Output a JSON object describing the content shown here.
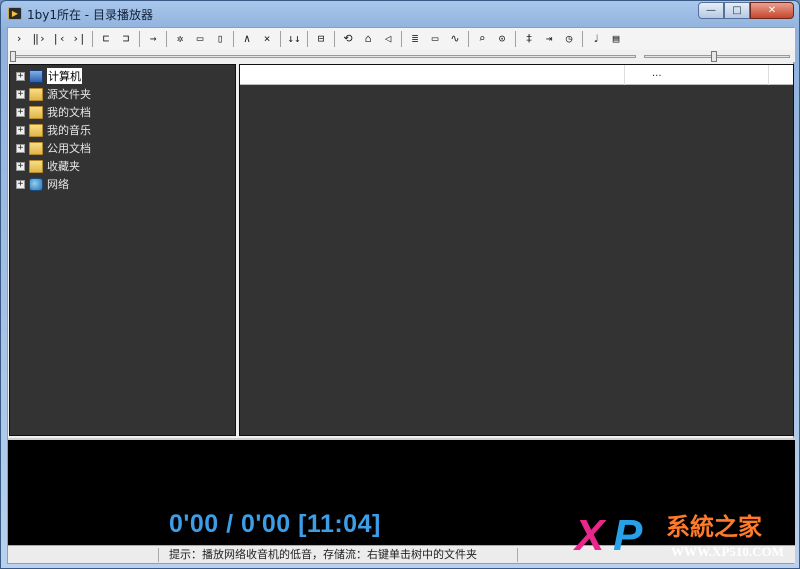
{
  "window": {
    "title": "1by1所在 - 目录播放器"
  },
  "titlebar_buttons": {
    "minimize": "—",
    "maximize": "□",
    "close": "✕"
  },
  "toolbar": [
    {
      "name": "play-icon",
      "glyph": "›"
    },
    {
      "name": "pause-icon",
      "glyph": "‖›"
    },
    {
      "name": "previous-icon",
      "glyph": "|‹"
    },
    {
      "name": "next-icon",
      "glyph": "›|"
    },
    {
      "sep": true
    },
    {
      "name": "folder-back-icon",
      "glyph": "⊏"
    },
    {
      "name": "folder-forward-icon",
      "glyph": "⊐"
    },
    {
      "sep": true
    },
    {
      "name": "jump-icon",
      "glyph": "→"
    },
    {
      "sep": true
    },
    {
      "name": "settings-icon",
      "glyph": "✲"
    },
    {
      "name": "minimize-view-icon",
      "glyph": "▭"
    },
    {
      "name": "panel-icon",
      "glyph": "▯"
    },
    {
      "sep": true
    },
    {
      "name": "up-icon",
      "glyph": "∧"
    },
    {
      "name": "delete-icon",
      "glyph": "×"
    },
    {
      "sep": true
    },
    {
      "name": "sort-icon",
      "glyph": "↓↓"
    },
    {
      "sep": true
    },
    {
      "name": "layout-icon",
      "glyph": "⊟"
    },
    {
      "sep": true
    },
    {
      "name": "refresh-icon",
      "glyph": "⟲"
    },
    {
      "name": "home-icon",
      "glyph": "⌂"
    },
    {
      "name": "speaker-icon",
      "glyph": "◁"
    },
    {
      "sep": true
    },
    {
      "name": "playlist-icon",
      "glyph": "≣"
    },
    {
      "name": "keyboard-icon",
      "glyph": "▭"
    },
    {
      "name": "wave-file-icon",
      "glyph": "∿"
    },
    {
      "sep": true
    },
    {
      "name": "search-icon",
      "glyph": "⌕"
    },
    {
      "name": "search-advanced-icon",
      "glyph": "⊙"
    },
    {
      "sep": true
    },
    {
      "name": "list-options-icon",
      "glyph": "‡"
    },
    {
      "name": "exit-icon",
      "glyph": "⇥"
    },
    {
      "name": "clock-icon",
      "glyph": "◷"
    },
    {
      "sep": true
    },
    {
      "name": "music-note-icon",
      "glyph": "♩"
    },
    {
      "name": "info-icon",
      "glyph": "▤"
    }
  ],
  "seekbar": {
    "position_fraction": 0.0
  },
  "volume": {
    "level_fraction": 0.48
  },
  "tree": {
    "items": [
      {
        "label": "计算机",
        "icon": "computer-icon",
        "expander": "+",
        "selected": true
      },
      {
        "label": "源文件夹",
        "icon": "folder-icon",
        "expander": "+",
        "selected": false
      },
      {
        "label": "我的文档",
        "icon": "documents-icon",
        "expander": "+",
        "selected": false
      },
      {
        "label": "我的音乐",
        "icon": "music-folder-icon",
        "expander": "+",
        "selected": false
      },
      {
        "label": "公用文档",
        "icon": "public-documents-icon",
        "expander": "+",
        "selected": false
      },
      {
        "label": "收藏夹",
        "icon": "favorites-icon",
        "expander": "+",
        "selected": false
      },
      {
        "label": "网络",
        "icon": "network-icon",
        "expander": "+",
        "selected": false
      }
    ]
  },
  "list": {
    "overflow_label": "..."
  },
  "display": {
    "time": "0'00 / 0'00   [11:04]"
  },
  "status": {
    "hint": "提示：播放网络收音机的低音，存储流：右键单击树中的文件夹"
  },
  "watermark": {
    "x": "X",
    "p": "P",
    "site_name": "系統之家",
    "url": "WWW.XP510.COM"
  }
}
